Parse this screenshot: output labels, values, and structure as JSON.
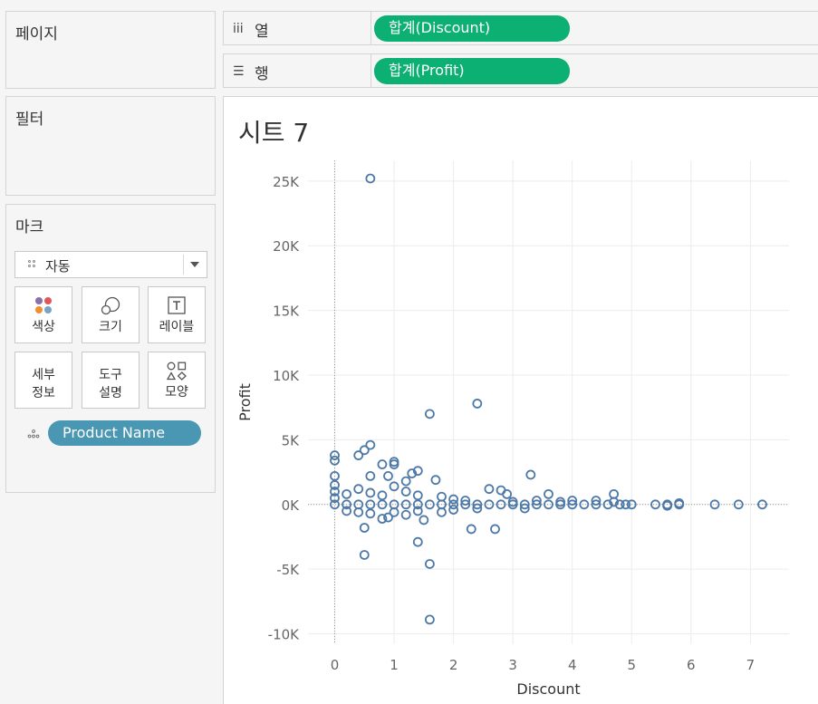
{
  "cards": {
    "pages_title": "페이지",
    "filters_title": "필터",
    "marks_title": "마크"
  },
  "marks": {
    "mark_type": "자동",
    "buttons": [
      {
        "label": "색상",
        "icon": "color-icon"
      },
      {
        "label": "크기",
        "icon": "size-icon"
      },
      {
        "label": "레이블",
        "icon": "label-icon"
      },
      {
        "label_line1": "세부",
        "label_line2": "정보",
        "icon": "detail"
      },
      {
        "label_line1": "도구",
        "label_line2": "설명",
        "icon": "tooltip"
      },
      {
        "label": "모양",
        "icon": "shape-icon"
      }
    ],
    "detail_pill": "Product Name"
  },
  "shelves": {
    "columns_label": "열",
    "columns_pill": "합계(Discount)",
    "rows_label": "행",
    "rows_pill": "합계(Profit)"
  },
  "sheet_title": "시트 7",
  "colors": {
    "green_pill": "#0cb072",
    "blue_pill": "#4a97b3",
    "mark": "#4e79a7"
  },
  "chart_data": {
    "type": "scatter",
    "xlabel": "Discount",
    "ylabel": "Profit",
    "xlim": [
      -0.45,
      7.65
    ],
    "ylim": [
      -10800,
      26600
    ],
    "x_ticks": [
      0,
      1,
      2,
      3,
      4,
      5,
      6,
      7
    ],
    "y_ticks": [
      -10000,
      -5000,
      0,
      5000,
      10000,
      15000,
      20000,
      25000
    ],
    "y_tick_labels": [
      "-10K",
      "-5K",
      "0K",
      "5K",
      "10K",
      "15K",
      "20K",
      "25K"
    ],
    "x_tick_labels": [
      "0",
      "1",
      "2",
      "3",
      "4",
      "5",
      "6",
      "7"
    ],
    "grid": true,
    "points": [
      [
        0.6,
        25200
      ],
      [
        2.4,
        7800
      ],
      [
        1.6,
        7000
      ],
      [
        3.3,
        2300
      ],
      [
        0.6,
        4600
      ],
      [
        0.5,
        4200
      ],
      [
        0.4,
        3800
      ],
      [
        0.0,
        3800
      ],
      [
        0.0,
        3400
      ],
      [
        1.0,
        3300
      ],
      [
        1.0,
        3100
      ],
      [
        0.8,
        3100
      ],
      [
        1.4,
        2600
      ],
      [
        1.3,
        2400
      ],
      [
        0.6,
        2200
      ],
      [
        0.9,
        2200
      ],
      [
        1.7,
        1900
      ],
      [
        1.2,
        1800
      ],
      [
        0.0,
        2200
      ],
      [
        2.6,
        1200
      ],
      [
        2.8,
        1100
      ],
      [
        2.9,
        800
      ],
      [
        3.6,
        800
      ],
      [
        4.7,
        800
      ],
      [
        0.5,
        -1800
      ],
      [
        0.8,
        -1100
      ],
      [
        2.3,
        -1900
      ],
      [
        2.7,
        -1900
      ],
      [
        1.4,
        -2900
      ],
      [
        0.5,
        -3900
      ],
      [
        1.6,
        -4600
      ],
      [
        1.6,
        -8900
      ],
      [
        1.5,
        -1200
      ],
      [
        0.9,
        -1000
      ],
      [
        6.4,
        0
      ],
      [
        6.8,
        0
      ],
      [
        7.2,
        0
      ],
      [
        5.8,
        0
      ],
      [
        5.6,
        0
      ],
      [
        5.4,
        0
      ],
      [
        5.0,
        0
      ],
      [
        4.9,
        0
      ],
      [
        4.8,
        0
      ],
      [
        4.6,
        0
      ],
      [
        4.4,
        0
      ],
      [
        4.2,
        0
      ],
      [
        4.0,
        0
      ],
      [
        3.8,
        0
      ],
      [
        3.6,
        0
      ],
      [
        3.4,
        0
      ],
      [
        3.2,
        0
      ],
      [
        3.0,
        0
      ],
      [
        2.8,
        0
      ],
      [
        2.6,
        0
      ],
      [
        2.4,
        0
      ],
      [
        2.2,
        0
      ],
      [
        2.0,
        0
      ],
      [
        1.8,
        0
      ],
      [
        1.6,
        0
      ],
      [
        1.4,
        0
      ],
      [
        1.2,
        0
      ],
      [
        1.0,
        0
      ],
      [
        0.8,
        0
      ],
      [
        0.6,
        0
      ],
      [
        0.4,
        0
      ],
      [
        0.2,
        0
      ],
      [
        0.0,
        0
      ],
      [
        0.0,
        500
      ],
      [
        0.0,
        1000
      ],
      [
        0.0,
        1500
      ],
      [
        0.2,
        800
      ],
      [
        0.4,
        1200
      ],
      [
        0.6,
        900
      ],
      [
        0.8,
        700
      ],
      [
        1.0,
        1400
      ],
      [
        1.2,
        1000
      ],
      [
        1.4,
        700
      ],
      [
        1.8,
        600
      ],
      [
        2.0,
        400
      ],
      [
        2.2,
        300
      ],
      [
        0.2,
        -500
      ],
      [
        0.4,
        -600
      ],
      [
        0.6,
        -700
      ],
      [
        1.0,
        -600
      ],
      [
        1.2,
        -800
      ],
      [
        1.4,
        -500
      ],
      [
        1.8,
        -600
      ],
      [
        2.0,
        -400
      ],
      [
        2.4,
        -300
      ],
      [
        3.2,
        -300
      ],
      [
        3.4,
        300
      ],
      [
        4.0,
        300
      ],
      [
        4.4,
        300
      ],
      [
        4.7,
        200
      ],
      [
        3.8,
        200
      ],
      [
        3.0,
        200
      ],
      [
        5.6,
        -100
      ],
      [
        5.8,
        100
      ]
    ]
  }
}
